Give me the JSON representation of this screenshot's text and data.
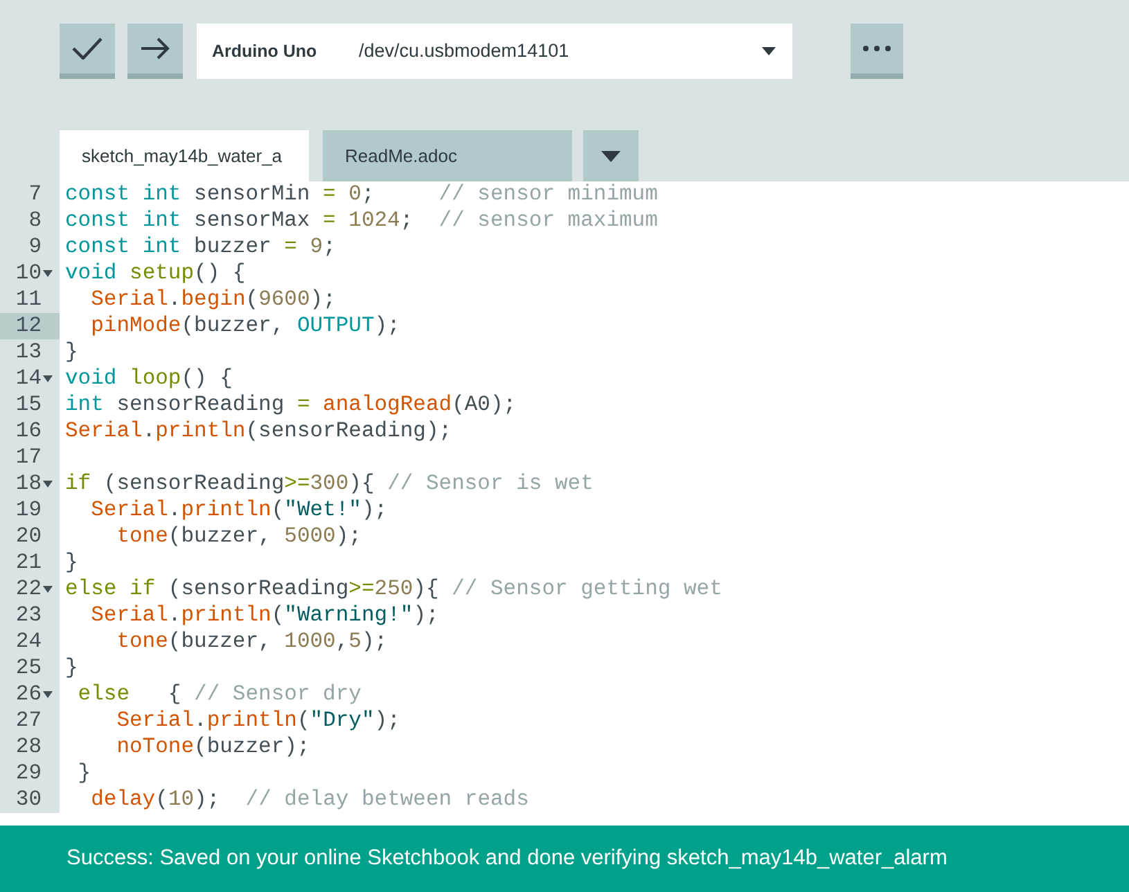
{
  "toolbar": {
    "board": "Arduino Uno",
    "port": "/dev/cu.usbmodem14101"
  },
  "tabs": [
    {
      "label": "sketch_may14b_water_a",
      "selected": true
    },
    {
      "label": "ReadMe.adoc",
      "selected": false
    }
  ],
  "code_lines": [
    {
      "number": "7",
      "fold": false,
      "selected": false,
      "tokens": [
        {
          "kind": "kw",
          "text": "const "
        },
        {
          "kind": "kw",
          "text": "int"
        },
        {
          "kind": "plain",
          "text": " sensorMin "
        },
        {
          "kind": "op",
          "text": "= "
        },
        {
          "kind": "num",
          "text": "0"
        },
        {
          "kind": "plain",
          "text": ";     "
        },
        {
          "kind": "comment",
          "text": "// sensor minimum"
        }
      ]
    },
    {
      "number": "8",
      "fold": false,
      "selected": false,
      "tokens": [
        {
          "kind": "kw",
          "text": "const "
        },
        {
          "kind": "kw",
          "text": "int"
        },
        {
          "kind": "plain",
          "text": " sensorMax "
        },
        {
          "kind": "op",
          "text": "= "
        },
        {
          "kind": "num",
          "text": "1024"
        },
        {
          "kind": "plain",
          "text": ";  "
        },
        {
          "kind": "comment",
          "text": "// sensor maximum"
        }
      ]
    },
    {
      "number": "9",
      "fold": false,
      "selected": false,
      "tokens": [
        {
          "kind": "kw",
          "text": "const "
        },
        {
          "kind": "kw",
          "text": "int"
        },
        {
          "kind": "plain",
          "text": " buzzer "
        },
        {
          "kind": "op",
          "text": "= "
        },
        {
          "kind": "num",
          "text": "9"
        },
        {
          "kind": "plain",
          "text": ";"
        }
      ]
    },
    {
      "number": "10",
      "fold": true,
      "selected": false,
      "tokens": [
        {
          "kind": "kw",
          "text": "void "
        },
        {
          "kind": "ctl",
          "text": "setup"
        },
        {
          "kind": "plain",
          "text": "() {"
        }
      ]
    },
    {
      "number": "11",
      "fold": false,
      "selected": false,
      "tokens": [
        {
          "kind": "fn",
          "text": "  Serial"
        },
        {
          "kind": "plain",
          "text": "."
        },
        {
          "kind": "fn",
          "text": "begin"
        },
        {
          "kind": "plain",
          "text": "("
        },
        {
          "kind": "num",
          "text": "9600"
        },
        {
          "kind": "plain",
          "text": ");"
        }
      ]
    },
    {
      "number": "12",
      "fold": false,
      "selected": true,
      "tokens": [
        {
          "kind": "fn",
          "text": "  pinMode"
        },
        {
          "kind": "plain",
          "text": "(buzzer, "
        },
        {
          "kind": "kw",
          "text": "OUTPUT"
        },
        {
          "kind": "plain",
          "text": ");"
        }
      ]
    },
    {
      "number": "13",
      "fold": false,
      "selected": false,
      "tokens": [
        {
          "kind": "plain",
          "text": "}"
        }
      ]
    },
    {
      "number": "14",
      "fold": true,
      "selected": false,
      "tokens": [
        {
          "kind": "kw",
          "text": "void "
        },
        {
          "kind": "ctl",
          "text": "loop"
        },
        {
          "kind": "plain",
          "text": "() {"
        }
      ]
    },
    {
      "number": "15",
      "fold": false,
      "selected": false,
      "tokens": [
        {
          "kind": "kw",
          "text": "int"
        },
        {
          "kind": "plain",
          "text": " sensorReading "
        },
        {
          "kind": "op",
          "text": "= "
        },
        {
          "kind": "fn",
          "text": "analogRead"
        },
        {
          "kind": "plain",
          "text": "(A0);"
        }
      ]
    },
    {
      "number": "16",
      "fold": false,
      "selected": false,
      "tokens": [
        {
          "kind": "fn",
          "text": "Serial"
        },
        {
          "kind": "plain",
          "text": "."
        },
        {
          "kind": "fn",
          "text": "println"
        },
        {
          "kind": "plain",
          "text": "(sensorReading);"
        }
      ]
    },
    {
      "number": "17",
      "fold": false,
      "selected": false
    },
    {
      "number": "18",
      "fold": true,
      "selected": false,
      "tokens": [
        {
          "kind": "ctl",
          "text": "if"
        },
        {
          "kind": "plain",
          "text": " (sensorReading"
        },
        {
          "kind": "op",
          "text": ">="
        },
        {
          "kind": "num",
          "text": "300"
        },
        {
          "kind": "plain",
          "text": "){ "
        },
        {
          "kind": "comment",
          "text": "// Sensor is wet"
        }
      ]
    },
    {
      "number": "19",
      "fold": false,
      "selected": false,
      "tokens": [
        {
          "kind": "fn",
          "text": "  Serial"
        },
        {
          "kind": "plain",
          "text": "."
        },
        {
          "kind": "fn",
          "text": "println"
        },
        {
          "kind": "plain",
          "text": "("
        },
        {
          "kind": "str",
          "text": "\"Wet!\""
        },
        {
          "kind": "plain",
          "text": ");"
        }
      ]
    },
    {
      "number": "20",
      "fold": false,
      "selected": false,
      "tokens": [
        {
          "kind": "fn",
          "text": "    tone"
        },
        {
          "kind": "plain",
          "text": "(buzzer, "
        },
        {
          "kind": "num",
          "text": "5000"
        },
        {
          "kind": "plain",
          "text": ");"
        }
      ]
    },
    {
      "number": "21",
      "fold": false,
      "selected": false,
      "tokens": [
        {
          "kind": "plain",
          "text": "}"
        }
      ]
    },
    {
      "number": "22",
      "fold": true,
      "selected": false,
      "tokens": [
        {
          "kind": "ctl",
          "text": "else "
        },
        {
          "kind": "ctl",
          "text": "if"
        },
        {
          "kind": "plain",
          "text": " (sensorReading"
        },
        {
          "kind": "op",
          "text": ">="
        },
        {
          "kind": "num",
          "text": "250"
        },
        {
          "kind": "plain",
          "text": "){ "
        },
        {
          "kind": "comment",
          "text": "// Sensor getting wet"
        }
      ]
    },
    {
      "number": "23",
      "fold": false,
      "selected": false,
      "tokens": [
        {
          "kind": "fn",
          "text": "  Serial"
        },
        {
          "kind": "plain",
          "text": "."
        },
        {
          "kind": "fn",
          "text": "println"
        },
        {
          "kind": "plain",
          "text": "("
        },
        {
          "kind": "str",
          "text": "\"Warning!\""
        },
        {
          "kind": "plain",
          "text": ");"
        }
      ]
    },
    {
      "number": "24",
      "fold": false,
      "selected": false,
      "tokens": [
        {
          "kind": "fn",
          "text": "    tone"
        },
        {
          "kind": "plain",
          "text": "(buzzer, "
        },
        {
          "kind": "num",
          "text": "1000"
        },
        {
          "kind": "plain",
          "text": ","
        },
        {
          "kind": "num",
          "text": "5"
        },
        {
          "kind": "plain",
          "text": ");"
        }
      ]
    },
    {
      "number": "25",
      "fold": false,
      "selected": false,
      "tokens": [
        {
          "kind": "plain",
          "text": "}"
        }
      ]
    },
    {
      "number": "26",
      "fold": true,
      "selected": false,
      "tokens": [
        {
          "kind": "ctl",
          "text": " else"
        },
        {
          "kind": "plain",
          "text": "   { "
        },
        {
          "kind": "comment",
          "text": "// Sensor dry"
        }
      ]
    },
    {
      "number": "27",
      "fold": false,
      "selected": false,
      "tokens": [
        {
          "kind": "fn",
          "text": "    Serial"
        },
        {
          "kind": "plain",
          "text": "."
        },
        {
          "kind": "fn",
          "text": "println"
        },
        {
          "kind": "plain",
          "text": "("
        },
        {
          "kind": "str",
          "text": "\"Dry\""
        },
        {
          "kind": "plain",
          "text": ");"
        }
      ]
    },
    {
      "number": "28",
      "fold": false,
      "selected": false,
      "tokens": [
        {
          "kind": "fn",
          "text": "    noTone"
        },
        {
          "kind": "plain",
          "text": "(buzzer);"
        }
      ]
    },
    {
      "number": "29",
      "fold": false,
      "selected": false,
      "tokens": [
        {
          "kind": "plain",
          "text": " }"
        }
      ]
    },
    {
      "number": "30",
      "fold": false,
      "selected": false,
      "tokens": [
        {
          "kind": "fn",
          "text": "  delay"
        },
        {
          "kind": "plain",
          "text": "("
        },
        {
          "kind": "num",
          "text": "10"
        },
        {
          "kind": "plain",
          "text": ");  "
        },
        {
          "kind": "comment",
          "text": "// delay between reads"
        }
      ]
    }
  ],
  "status_bar": {
    "message": "Success: Saved on your online Sketchbook and done verifying sketch_may14b_water_alarm"
  }
}
